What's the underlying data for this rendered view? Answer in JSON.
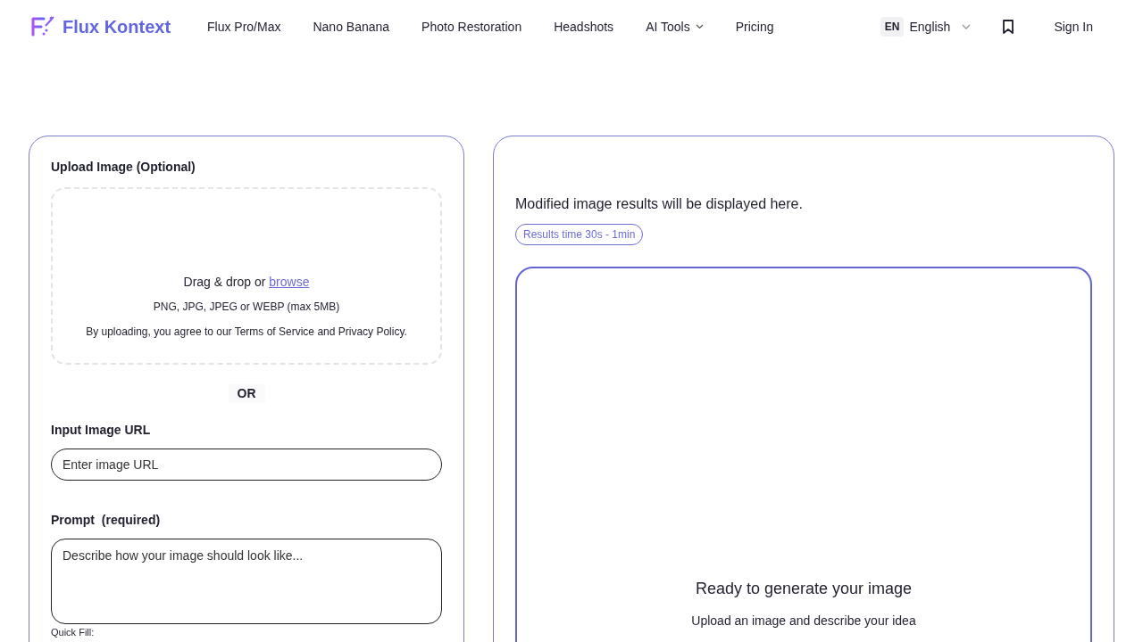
{
  "brand": {
    "name": "Flux Kontext"
  },
  "nav": [
    {
      "label": "Flux Pro/Max",
      "kind": "link"
    },
    {
      "label": "Nano Banana",
      "kind": "link"
    },
    {
      "label": "Photo Restoration",
      "kind": "link"
    },
    {
      "label": "Headshots",
      "kind": "link"
    },
    {
      "label": "AI Tools",
      "kind": "dropdown"
    },
    {
      "label": "Pricing",
      "kind": "link"
    }
  ],
  "language": {
    "code": "EN",
    "label": "English"
  },
  "sign_in": "Sign In",
  "upload": {
    "title": "Upload Image (Optional)",
    "drop_text": "Drag & drop or",
    "browse": "browse",
    "formats": "PNG, JPG, JPEG or WEBP (max 5MB)",
    "terms": "By uploading, you agree to our Terms of Service and Privacy Policy."
  },
  "or": "OR",
  "url_field": {
    "label": "Input Image URL",
    "placeholder": "Enter image URL"
  },
  "prompt_field": {
    "label": "Prompt  (required)",
    "placeholder": "Describe how your image should look like..."
  },
  "quick_fill": "Quick Fill:",
  "results": {
    "message": "Modified image results will be displayed here.",
    "badge": "Results time 30s - 1min",
    "ready_title": "Ready to generate your image",
    "ready_subtitle": "Upload an image and describe your idea"
  }
}
